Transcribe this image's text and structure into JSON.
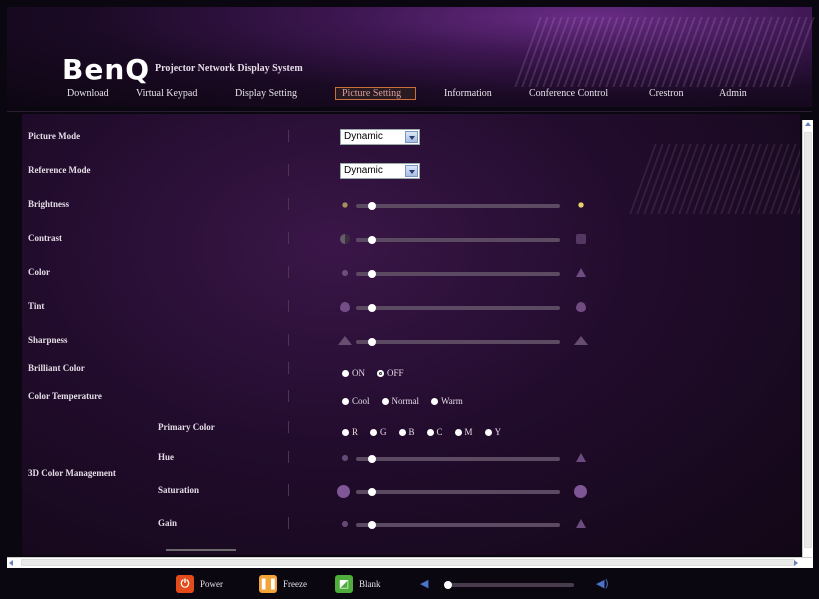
{
  "header": {
    "logo": "BenQ",
    "subtitle": "Projector Network Display System"
  },
  "nav": {
    "items": [
      {
        "label": "Download"
      },
      {
        "label": "Virtual Keypad"
      },
      {
        "label": "Display Setting"
      },
      {
        "label": "Picture Setting",
        "active": true
      },
      {
        "label": "Information"
      },
      {
        "label": "Conference Control"
      },
      {
        "label": "Crestron"
      },
      {
        "label": "Admin"
      }
    ]
  },
  "picture": {
    "picture_mode": {
      "label": "Picture Mode",
      "value": "Dynamic"
    },
    "reference_mode": {
      "label": "Reference Mode",
      "value": "Dynamic"
    },
    "brightness": {
      "label": "Brightness",
      "level": 0.08,
      "icon_left": "sun-dim-icon",
      "icon_right": "sun-bright-icon"
    },
    "contrast": {
      "label": "Contrast",
      "level": 0.08,
      "icon_left": "contrast-low-icon",
      "icon_right": "contrast-high-icon"
    },
    "color": {
      "label": "Color",
      "level": 0.08,
      "icon_left": "color-low-icon",
      "icon_right": "color-high-icon"
    },
    "tint": {
      "label": "Tint",
      "level": 0.08,
      "icon_left": "tint-low-icon",
      "icon_right": "tint-high-icon"
    },
    "sharpness": {
      "label": "Sharpness",
      "level": 0.08,
      "icon_left": "sharpness-low-icon",
      "icon_right": "sharpness-high-icon"
    },
    "brilliant_color": {
      "label": "Brilliant Color",
      "options": [
        "ON",
        "OFF"
      ],
      "selected": "OFF"
    },
    "color_temperature": {
      "label": "Color Temperature",
      "options": [
        "Cool",
        "Normal",
        "Warm"
      ],
      "selected": ""
    },
    "color_management": {
      "label": "3D Color Management",
      "primary_color": {
        "label": "Primary Color",
        "options": [
          "R",
          "G",
          "B",
          "C",
          "M",
          "Y"
        ]
      },
      "hue": {
        "label": "Hue",
        "level": 0.08
      },
      "saturation": {
        "label": "Saturation",
        "level": 0.08
      },
      "gain": {
        "label": "Gain",
        "level": 0.08
      }
    }
  },
  "footer": {
    "power_label": "Power",
    "freeze_label": "Freeze",
    "blank_label": "Blank",
    "volume_level": 0.0,
    "colors": {
      "power": "#e34b1b",
      "freeze": "#f2a33a",
      "blank": "#4fae3b",
      "speaker": "#4a74c7"
    }
  }
}
